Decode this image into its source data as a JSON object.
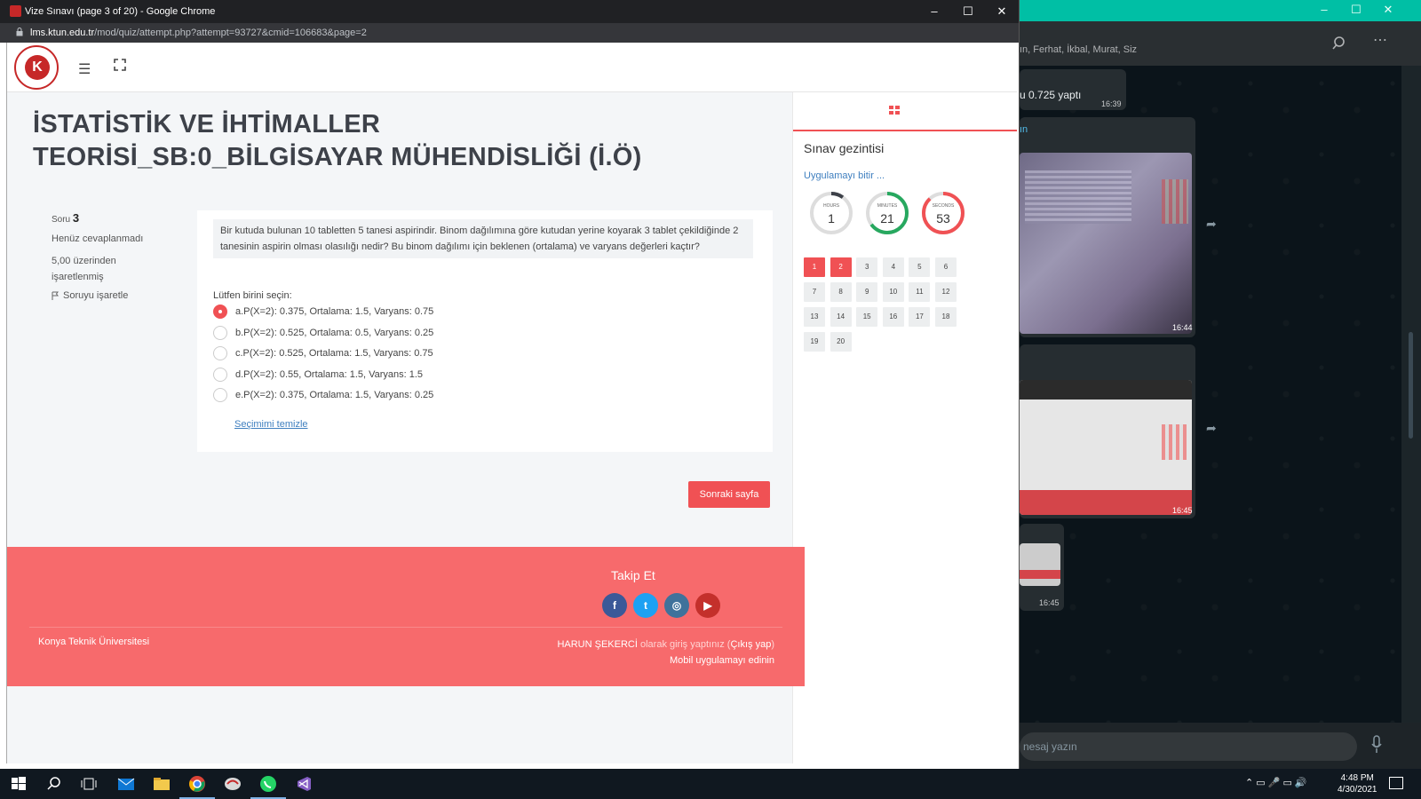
{
  "whatsapp": {
    "window_controls": [
      "–",
      "☐",
      "✕"
    ],
    "members": "ın, Ferhat, İkbal, Murat, Siz",
    "messages": [
      {
        "text": "u 0.725  yaptı",
        "time": "16:39"
      },
      {
        "sender": "ın",
        "time": "16:44"
      },
      {
        "time": "16:45"
      },
      {
        "time": "16:45"
      }
    ],
    "input_placeholder": "nesaj yazın"
  },
  "chrome": {
    "title": "Vize Sınavı (page 3 of 20) - Google Chrome",
    "url_host": "lms.ktun.edu.tr",
    "url_path": "/mod/quiz/attempt.php?attempt=93727&cmid=106683&page=2",
    "window_controls": [
      "–",
      "☐",
      "✕"
    ]
  },
  "page": {
    "course_title": "İSTATİSTİK VE İHTİMALLER TEORİSİ_SB:0_BİLGİSAYAR MÜHENDİSLİĞİ (İ.Ö)",
    "question_info": {
      "label": "Soru",
      "number": "3",
      "status": "Henüz cevaplanmadı",
      "marks": "5,00 üzerinden işaretlenmiş",
      "flag": "Soruyu işaretle"
    },
    "question": {
      "text": "Bir kutuda bulunan 10 tabletten 5 tanesi aspirindir. Binom dağılımına göre kutudan yerine koyarak 3 tablet çekildiğinde 2 tanesinin aspirin olması olasılığı nedir? Bu binom dağılımı için beklenen (ortalama) ve varyans değerleri kaçtır?",
      "prompt": "Lütfen birini seçin:",
      "options": [
        {
          "label": "a.P(X=2): 0.375, Ortalama: 1.5, Varyans: 0.75",
          "selected": true
        },
        {
          "label": "b.P(X=2): 0.525, Ortalama: 0.5, Varyans: 0.25",
          "selected": false
        },
        {
          "label": "c.P(X=2): 0.525, Ortalama: 1.5, Varyans: 0.75",
          "selected": false
        },
        {
          "label": "d.P(X=2): 0.55, Ortalama: 1.5, Varyans: 1.5",
          "selected": false
        },
        {
          "label": "e.P(X=2): 0.375, Ortalama: 1.5, Varyans: 0.25",
          "selected": false
        }
      ],
      "clear_choice": "Seçimimi temizle"
    },
    "next_button": "Sonraki sayfa",
    "footer": {
      "follow_title": "Takip Et",
      "social": [
        "f",
        "t",
        "◎",
        "▶"
      ],
      "social_colors": [
        "#3b5998",
        "#1da1f2",
        "#3f729b",
        "#c4302b"
      ],
      "university": "Konya Teknik Üniversitesi",
      "user_name": "HARUN ŞEKERCİ",
      "logged_in_as": " olarak giriş yaptınız (",
      "logout": "Çıkış yap",
      "logout_close": ")",
      "mobile_app": "Mobil uygulamayı edinin"
    },
    "sidebar": {
      "title": "Sınav gezintisi",
      "finish_link": "Uygulamayı bitir ...",
      "timers": [
        {
          "label": "HOURS",
          "value": "1",
          "fraction": 0.1,
          "color": "#3d4149"
        },
        {
          "label": "MINUTES",
          "value": "21",
          "fraction": 0.65,
          "color": "#27a85f"
        },
        {
          "label": "SECONDS",
          "value": "53",
          "fraction": 0.88,
          "color": "#f05154"
        }
      ],
      "questions": [
        "1",
        "2",
        "3",
        "4",
        "5",
        "6",
        "7",
        "8",
        "9",
        "10",
        "11",
        "12",
        "13",
        "14",
        "15",
        "16",
        "17",
        "18",
        "19",
        "20"
      ],
      "current_questions": [
        "1",
        "2"
      ]
    }
  },
  "taskbar": {
    "clock_time": "4:48 PM",
    "clock_date": "4/30/2021",
    "apps": [
      "windows-start",
      "search",
      "task-view",
      "mail",
      "file-explorer",
      "chrome",
      "app-dragon",
      "whatsapp",
      "visual-studio"
    ]
  }
}
